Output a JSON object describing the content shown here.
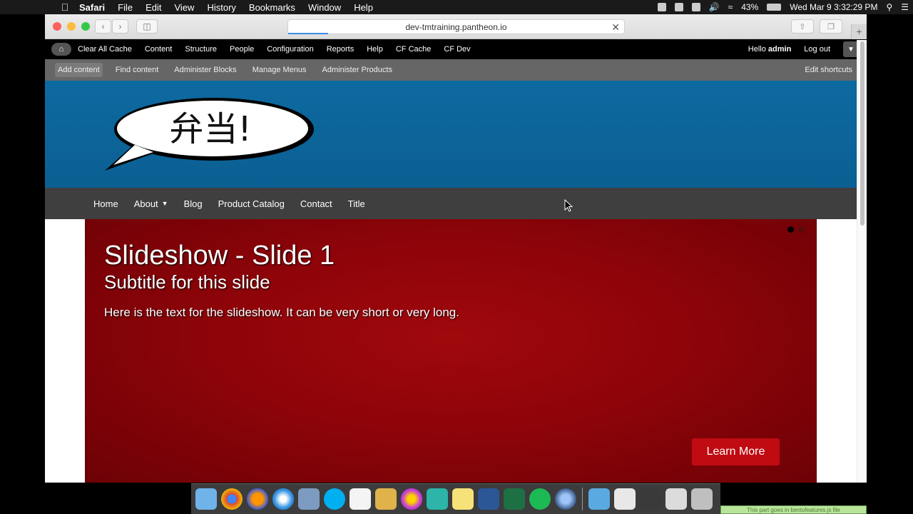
{
  "menubar": {
    "app": "Safari",
    "menus": [
      "File",
      "Edit",
      "View",
      "History",
      "Bookmarks",
      "Window",
      "Help"
    ],
    "battery": "43%",
    "clock": "Wed Mar 9  3:32:29 PM"
  },
  "browser": {
    "url": "dev-tmtraining.pantheon.io"
  },
  "admin_toolbar": {
    "items": [
      "Clear All Cache",
      "Content",
      "Structure",
      "People",
      "Configuration",
      "Reports",
      "Help",
      "CF Cache",
      "CF Dev"
    ],
    "hello_prefix": "Hello ",
    "username": "admin",
    "logout": "Log out"
  },
  "shortcuts": {
    "items": [
      "Add content",
      "Find content",
      "Administer Blocks",
      "Manage Menus",
      "Administer Products"
    ],
    "edit": "Edit shortcuts"
  },
  "header": {
    "logo_text": "弁当!"
  },
  "main_nav": {
    "items": [
      "Home",
      "About",
      "Blog",
      "Product Catalog",
      "Contact",
      "Title"
    ]
  },
  "slide": {
    "title": "Slideshow - Slide 1",
    "subtitle": "Subtitle for this slide",
    "text": "Here is the text for the slideshow. It can be very short or very long.",
    "button": "Learn More"
  },
  "dock": {
    "strip_text": "This part goes in bentofeatures.js file"
  },
  "colors": {
    "header_blue": "#0d6aa0",
    "slide_red": "#8e0409",
    "button_red": "#c00b13",
    "nav_dark": "#3f3f3f"
  }
}
